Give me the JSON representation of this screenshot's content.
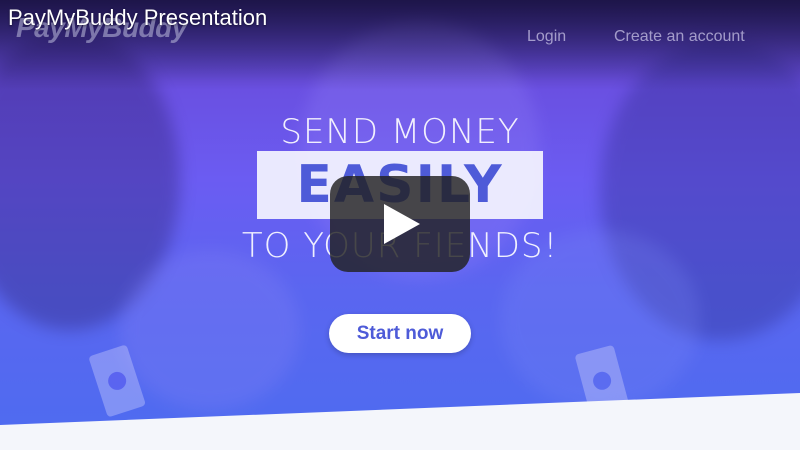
{
  "video": {
    "title": "PayMyBuddy Presentation"
  },
  "header": {
    "logo_text": "PayMyBuddy",
    "nav": {
      "login": "Login",
      "create_account": "Create an account"
    }
  },
  "hero": {
    "line1": "SEND MONEY",
    "line2": "EASILY",
    "line3": "TO YOUR FIENDS!",
    "cta": "Start now"
  },
  "icons": {
    "play": "play-icon",
    "money": "money-bill-icon"
  },
  "colors": {
    "accent": "#4e5bd8",
    "hero_gradient_top": "#3a2f8e",
    "hero_gradient_bottom": "#4d6cf0",
    "footer_band": "#f4f6fb",
    "play_button": "#212121"
  }
}
